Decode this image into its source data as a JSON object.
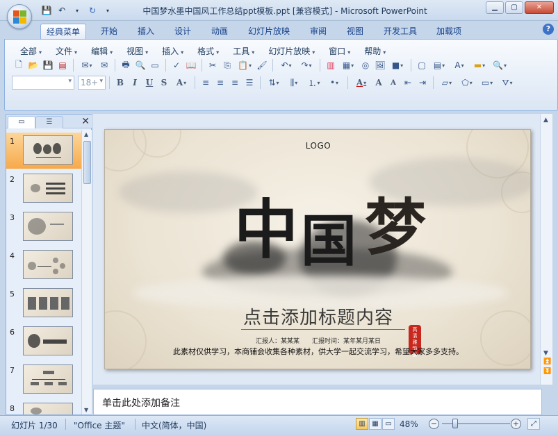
{
  "window": {
    "title": "中国梦水墨中国风工作总结ppt模板.ppt [兼容模式] - Microsoft PowerPoint",
    "minimize": "▁",
    "maximize": "▢",
    "close": "✕"
  },
  "tabs": [
    "经典菜单",
    "开始",
    "插入",
    "设计",
    "动画",
    "幻灯片放映",
    "审阅",
    "视图",
    "开发工具",
    "加载项"
  ],
  "active_tab": "经典菜单",
  "classic_menu": [
    "全部",
    "文件",
    "编辑",
    "视图",
    "插入",
    "格式",
    "工具",
    "幻灯片放映",
    "窗口",
    "帮助"
  ],
  "font": {
    "name_value": "",
    "size_value": "18+"
  },
  "slides_pane": {
    "slides": [
      {
        "num": "1"
      },
      {
        "num": "2"
      },
      {
        "num": "3"
      },
      {
        "num": "4"
      },
      {
        "num": "5"
      },
      {
        "num": "6"
      },
      {
        "num": "7"
      },
      {
        "num": "8"
      }
    ],
    "selected": 1
  },
  "slide": {
    "logo": "LOGO",
    "title_chars": [
      "中",
      "国",
      "梦"
    ],
    "subtitle": "点击添加标题内容",
    "reporter": "汇报人：某某某　　汇报时间：某年某月某日",
    "notice": "此素材仅供学习，本商铺会收集各种素材，供大学一起交流学习，希望大家多多支持。",
    "seal_text": "高清雅韵墨"
  },
  "notes": {
    "placeholder": "单击此处添加备注"
  },
  "status": {
    "slide_counter": "幻灯片 1/30",
    "theme": "\"Office 主题\"",
    "language": "中文(简体，中国)",
    "zoom": "48%"
  },
  "colors": {
    "ribbon_bg": "#dbe6f4",
    "active_thumb": "#f7a94a",
    "seal": "#c7271d"
  }
}
